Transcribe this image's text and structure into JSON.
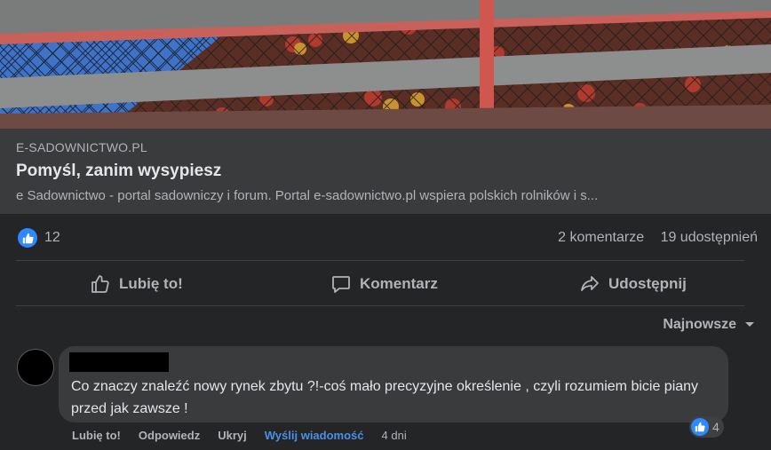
{
  "link_preview": {
    "domain": "E-SADOWNICTWO.PL",
    "title": "Pomyśl, zanim wysypiesz",
    "description": "e Sadownictwo - portal sadowniczy i forum. Portal e-sadownictwo.pl wspiera polskich rolników i s..."
  },
  "stats": {
    "like_count": "12",
    "comments": "2 komentarze",
    "shares": "19 udostępnień"
  },
  "actions": {
    "like": "Lubię to!",
    "comment": "Komentarz",
    "share": "Udostępnij"
  },
  "sort": {
    "label": "Najnowsze"
  },
  "comment": {
    "text": "Co znaczy znaleźć nowy rynek zbytu ?!-coś mało precyzyjne określenie , czyli rozumiem bicie piany przed jak zawsze !",
    "reaction_count": "4",
    "actions": {
      "like": "Lubię to!",
      "reply": "Odpowiedz",
      "hide": "Ukryj",
      "message": "Wyślij wiadomość",
      "time": "4 dni"
    }
  },
  "colors": {
    "background": "#242526",
    "card": "#3a3b3c",
    "accent_blue": "#2e89ff",
    "link_blue": "#4a8fe7"
  }
}
